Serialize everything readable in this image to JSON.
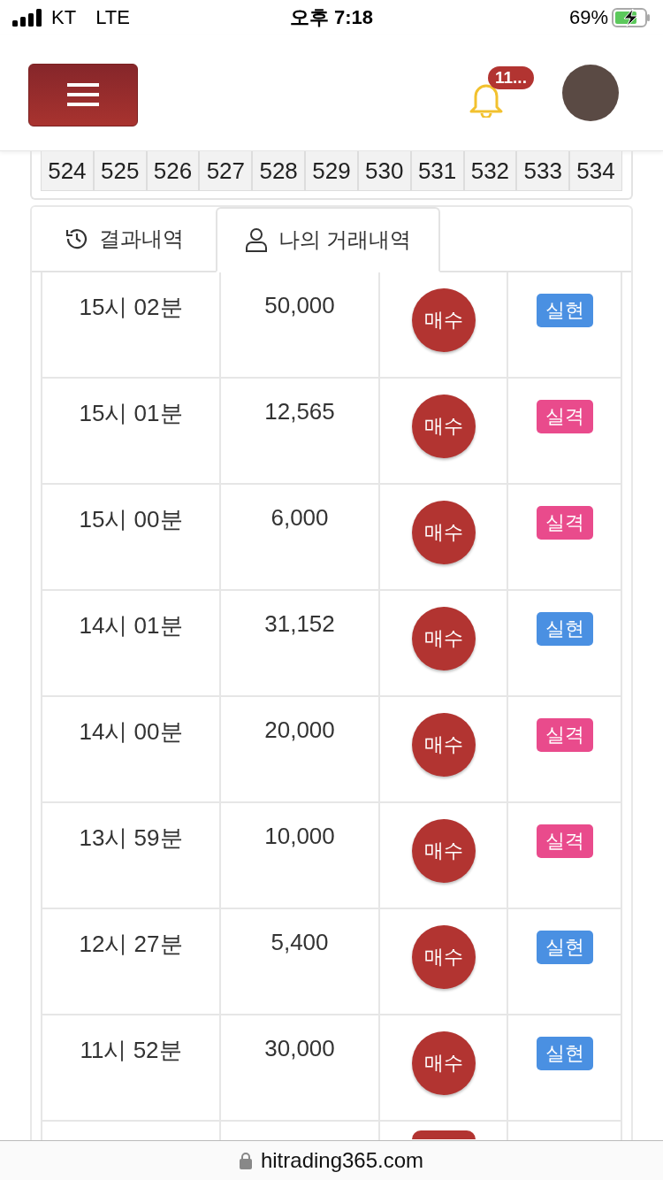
{
  "status_bar": {
    "carrier": "KT",
    "network": "LTE",
    "time": "오후 7:18",
    "battery": "69%"
  },
  "header": {
    "notification_count": "11..."
  },
  "round_numbers": [
    "524",
    "525",
    "526",
    "527",
    "528",
    "529",
    "530",
    "531",
    "532",
    "533",
    "534"
  ],
  "tabs": [
    {
      "label": "결과내역",
      "kind": "history",
      "selected": false
    },
    {
      "label": "나의 거래내역",
      "kind": "user",
      "selected": true
    }
  ],
  "trades": [
    {
      "time": "15시 02분",
      "amount": "50,000",
      "action": "매수",
      "result": "실현",
      "color": "#4a90e2"
    },
    {
      "time": "15시 01분",
      "amount": "12,565",
      "action": "매수",
      "result": "실격",
      "color": "#e94b8c"
    },
    {
      "time": "15시 00분",
      "amount": "6,000",
      "action": "매수",
      "result": "실격",
      "color": "#e94b8c"
    },
    {
      "time": "14시 01분",
      "amount": "31,152",
      "action": "매수",
      "result": "실현",
      "color": "#4a90e2"
    },
    {
      "time": "14시 00분",
      "amount": "20,000",
      "action": "매수",
      "result": "실격",
      "color": "#e94b8c"
    },
    {
      "time": "13시 59분",
      "amount": "10,000",
      "action": "매수",
      "result": "실격",
      "color": "#e94b8c"
    },
    {
      "time": "12시 27분",
      "amount": "5,400",
      "action": "매수",
      "result": "실현",
      "color": "#4a90e2"
    },
    {
      "time": "11시 52분",
      "amount": "30,000",
      "action": "매수",
      "result": "실현",
      "color": "#4a90e2"
    }
  ],
  "url_bar": {
    "url": "hitrading365.com"
  }
}
